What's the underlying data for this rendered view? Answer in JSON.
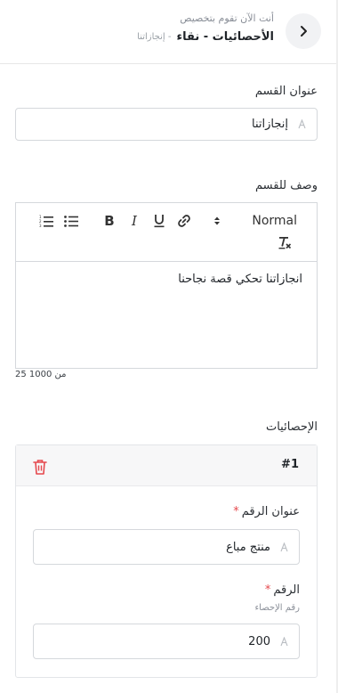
{
  "header": {
    "subtitle": "أنت الآن تقوم بتخصيص",
    "title": "الأحصائيات - نقاء",
    "crumb": "- إنجازاتنا"
  },
  "section_title": {
    "label": "عنوان القسم",
    "value": "إنجازاتنا"
  },
  "description": {
    "label": "وصف للقسم",
    "toolbar": {
      "format_select": "Normal"
    },
    "content": "انجازاتنا تحكي قصة نجاحنا",
    "counter": "25 من 1000"
  },
  "statistics": {
    "label": "الإحصائيات",
    "items": [
      {
        "index": "#1",
        "number_title_label": "عنوان الرقم",
        "number_title_value": "منتج مباع",
        "number_label": "الرقم",
        "number_hint": "رقم الإحصاء",
        "number_value": "200",
        "required_mark": "*"
      }
    ]
  },
  "colors": {
    "danger": "#e5484d",
    "border": "#d5d8dc"
  }
}
